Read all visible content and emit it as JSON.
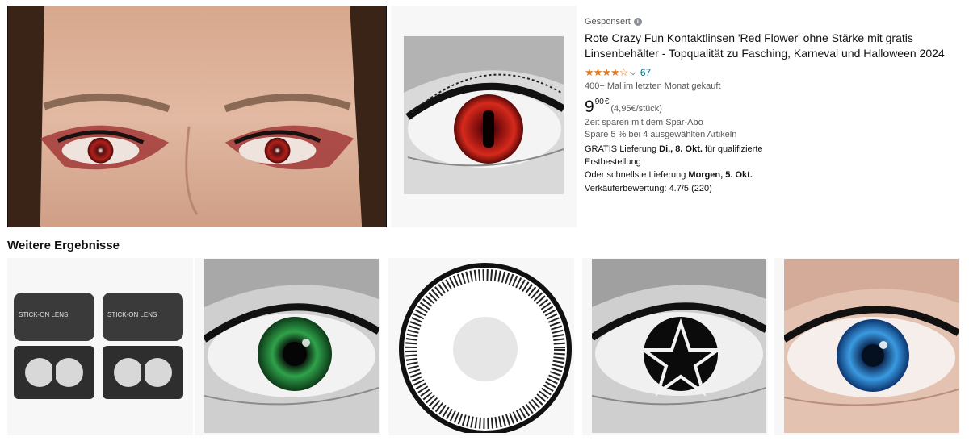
{
  "hero": {
    "image_icon": "red-eyes-face-image"
  },
  "product": {
    "sponsored_label": "Gesponsert",
    "info_icon": "info-icon",
    "title": "Rote Crazy Fun Kontaktlinsen 'Red Flower' ohne Stärke mit gratis Linsenbehälter - Topqualität zu Fasching, Karneval und Halloween 2024",
    "rating_stars": "★★★★☆",
    "rating_value": 4.0,
    "rating_count": "67",
    "bought_text": "400+ Mal im letzten Monat gekauft",
    "price_whole": "9",
    "price_fraction": "90",
    "price_currency": "€",
    "unit_price": "(4,95€/stück)",
    "subscribe_text": "Zeit sparen mit dem Spar-Abo",
    "save_text": "Spare 5 % bei 4 ausgewählten Artikeln",
    "delivery_prefix": "GRATIS Lieferung ",
    "delivery_date": "Di., 8. Okt.",
    "delivery_suffix": " für qualifizierte",
    "delivery_line2": "Erstbestellung",
    "fast_prefix": "Oder schnellste Lieferung ",
    "fast_date": "Morgen, 5. Okt.",
    "seller_rating": "Verkäuferbewertung: 4.7/5 (220)"
  },
  "more_results": {
    "heading": "Weitere Ergebnisse",
    "items": [
      {
        "icon": "lens-case-image",
        "case_text": "STICK-ON LENS"
      },
      {
        "icon": "green-lens-eye-image"
      },
      {
        "icon": "white-sclera-lens-image"
      },
      {
        "icon": "pentagram-lens-eye-image"
      },
      {
        "icon": "blue-lens-eye-image"
      }
    ]
  },
  "colors": {
    "link": "#007185",
    "star": "#de7921",
    "text": "#0f1111",
    "muted": "#565959",
    "tile_bg": "#f7f7f7"
  }
}
